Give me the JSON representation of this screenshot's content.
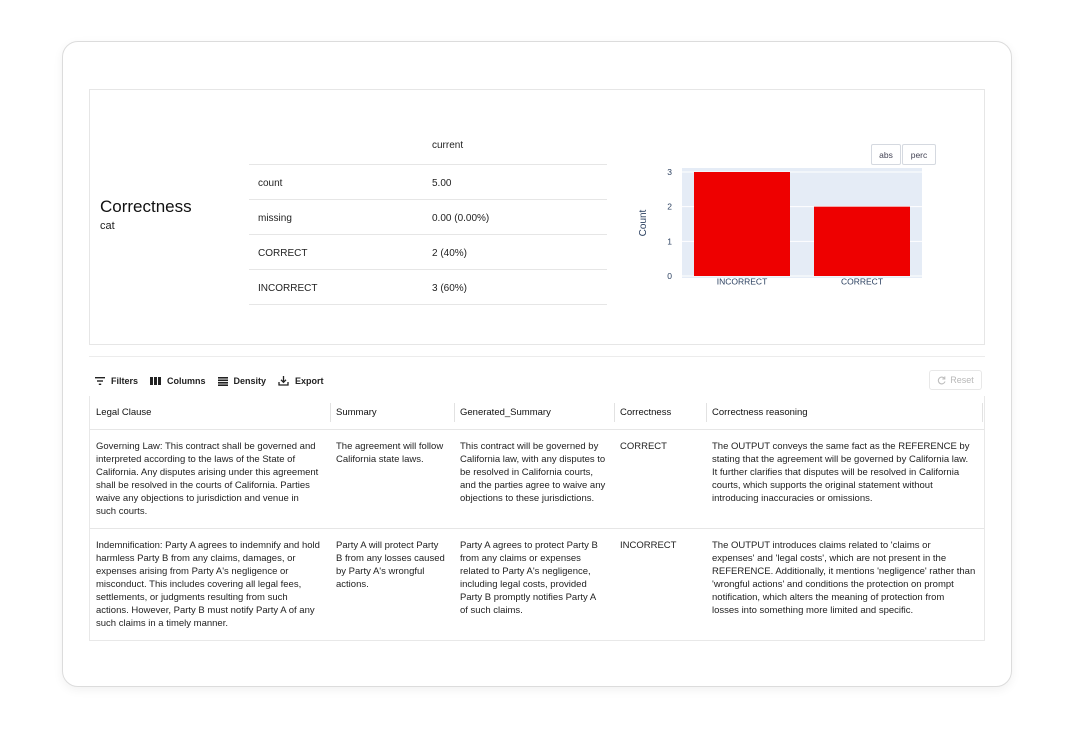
{
  "feature": {
    "name": "Correctness",
    "type": "cat"
  },
  "stats": {
    "column_header": "current",
    "rows": [
      {
        "label": "count",
        "value": "5.00"
      },
      {
        "label": "missing",
        "value": "0.00 (0.00%)"
      },
      {
        "label": "CORRECT",
        "value": "2 (40%)"
      },
      {
        "label": "INCORRECT",
        "value": "3 (60%)"
      }
    ]
  },
  "chart_toggle": {
    "abs_label": "abs",
    "perc_label": "perc",
    "selected": "abs"
  },
  "chart_data": {
    "type": "bar",
    "categories": [
      "INCORRECT",
      "CORRECT"
    ],
    "values": [
      3,
      2
    ],
    "ylabel": "Count",
    "ylim": [
      0,
      3
    ],
    "yticks": [
      0,
      1,
      2,
      3
    ],
    "color": "#ee0000",
    "background": "#e5ecf6",
    "grid": true
  },
  "toolbar": {
    "filters_label": "Filters",
    "columns_label": "Columns",
    "density_label": "Density",
    "export_label": "Export",
    "reset_label": "Reset"
  },
  "table": {
    "headers": [
      "Legal Clause",
      "Summary",
      "Generated_Summary",
      "Correctness",
      "Correctness reasoning"
    ],
    "rows": [
      {
        "legal_clause": [
          "Governing Law: This contract shall be governed and",
          "interpreted according to the laws of the State of",
          "California. Any disputes arising under this agreement",
          "shall be resolved in the courts of California. Parties",
          "waive any objections to jurisdiction and venue in",
          "such courts."
        ],
        "summary": [
          "The agreement will follow",
          "California state laws."
        ],
        "generated_summary": [
          "This contract will be governed by",
          "California law, with any disputes to",
          "be resolved in California courts,",
          "and the parties agree to waive any",
          "objections to these jurisdictions."
        ],
        "correctness": "CORRECT",
        "reasoning": [
          "The OUTPUT conveys the same fact as the REFERENCE by",
          "stating that the agreement will be governed by California law.",
          "It further clarifies that disputes will be resolved in California",
          "courts, which supports the original statement without",
          "introducing inaccuracies or omissions."
        ]
      },
      {
        "legal_clause": [
          "Indemnification: Party A agrees to indemnify and hold",
          "harmless Party B from any claims, damages, or",
          "expenses arising from Party A's negligence or",
          "misconduct. This includes covering all legal fees,",
          "settlements, or judgments resulting from such",
          "actions. However, Party B must notify Party A of any",
          "such claims in a timely manner."
        ],
        "summary": [
          "Party A will protect Party",
          "B from any losses caused",
          "by Party A's wrongful",
          "actions."
        ],
        "generated_summary": [
          "Party A agrees to protect Party B",
          "from any claims or expenses",
          "related to Party A's negligence,",
          "including legal costs, provided",
          "Party B promptly notifies Party A",
          "of such claims."
        ],
        "correctness": "INCORRECT",
        "reasoning": [
          "The OUTPUT introduces claims related to 'claims or",
          "expenses' and 'legal costs', which are not present in the",
          "REFERENCE. Additionally, it mentions 'negligence' rather than",
          "'wrongful actions' and conditions the protection on prompt",
          "notification, which alters the meaning of protection from",
          "losses into something more limited and specific."
        ]
      }
    ]
  }
}
